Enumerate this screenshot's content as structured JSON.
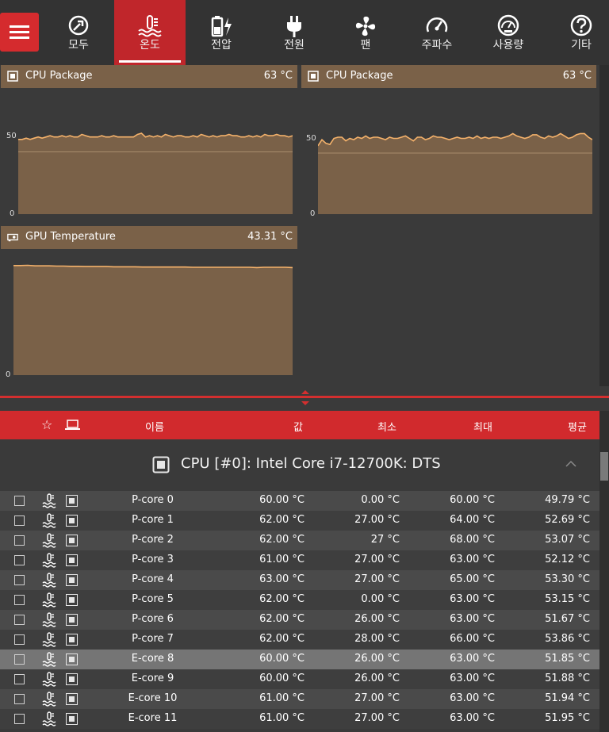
{
  "nav": {
    "items": [
      {
        "label": "모두",
        "icon": "wrench-gauge-icon"
      },
      {
        "label": "온도",
        "icon": "thermometer-icon",
        "active": true
      },
      {
        "label": "전압",
        "icon": "battery-bolt-icon"
      },
      {
        "label": "전원",
        "icon": "plug-icon"
      },
      {
        "label": "팬",
        "icon": "fan-icon"
      },
      {
        "label": "주파수",
        "icon": "speedometer-icon"
      },
      {
        "label": "사용량",
        "icon": "usage-gauge-icon"
      },
      {
        "label": "기타",
        "icon": "question-icon"
      }
    ]
  },
  "graphs": [
    {
      "title": "CPU Package",
      "value": "63 °C",
      "icon": "cpu-chip-icon",
      "y_ticks": [
        "50",
        "0"
      ],
      "ylim": [
        0,
        100
      ],
      "series": [
        60,
        60,
        61,
        60,
        61,
        62,
        61,
        62,
        63,
        62,
        62,
        63,
        62,
        63,
        62,
        62,
        64,
        63,
        62,
        62,
        62,
        63,
        62,
        62,
        63,
        62,
        62,
        62,
        62,
        62,
        64,
        65,
        62,
        63,
        62,
        63,
        62,
        64,
        63,
        62,
        63,
        63,
        62,
        62,
        63,
        62,
        64,
        63,
        62,
        63,
        62,
        63,
        63,
        64,
        63,
        63,
        62,
        62,
        63,
        62,
        63,
        62,
        64,
        63,
        63,
        64,
        63,
        63,
        62,
        63
      ]
    },
    {
      "title": "CPU Package",
      "value": "63 °C",
      "icon": "cpu-chip-icon",
      "y_ticks": [
        "50",
        "0"
      ],
      "ylim": [
        0,
        100
      ],
      "series": [
        56,
        61,
        58,
        57,
        62,
        63,
        63,
        60,
        62,
        61,
        63,
        62,
        64,
        62,
        63,
        63,
        62,
        61,
        63,
        62,
        62,
        63,
        64,
        62,
        60,
        63,
        63,
        61,
        62,
        64,
        63,
        63,
        62,
        61,
        62,
        63,
        62,
        62,
        63,
        62,
        64,
        62,
        63,
        62,
        63,
        63,
        62,
        63,
        64,
        66,
        64,
        63,
        62,
        63,
        65,
        65,
        63,
        62,
        64,
        63,
        64,
        66,
        64,
        62,
        63,
        65,
        66,
        66,
        63,
        61
      ]
    },
    {
      "title": "GPU Temperature",
      "value": "43.31 °C",
      "icon": "gpu-card-icon",
      "y_ticks": [
        "0"
      ],
      "ylim": [
        0,
        50
      ],
      "series": [
        44.0,
        44.0,
        44.1,
        43.9,
        43.9,
        43.9,
        43.8,
        43.8,
        43.7,
        43.7,
        43.6,
        43.6,
        43.6,
        43.6,
        43.5,
        43.5,
        43.5,
        43.5,
        43.4,
        43.4,
        43.4,
        43.4,
        43.4,
        43.4,
        43.4,
        43.3,
        43.3,
        43.3,
        43.3,
        43.3,
        43.3,
        43.3,
        43.3,
        43.3,
        43.2,
        43.3,
        43.3,
        43.3,
        43.3,
        43.2
      ]
    }
  ],
  "table": {
    "header": {
      "star": "☆",
      "name": "이름",
      "value": "값",
      "min": "최소",
      "max": "최대",
      "avg": "평균"
    },
    "group_title": "CPU [#0]: Intel Core i7-12700K: DTS",
    "rows": [
      {
        "name": "P-core 0",
        "value": "60.00 °C",
        "min": "0.00 °C",
        "max": "60.00 °C",
        "avg": "49.79 °C"
      },
      {
        "name": "P-core 1",
        "value": "62.00 °C",
        "min": "27.00 °C",
        "max": "64.00 °C",
        "avg": "52.69 °C"
      },
      {
        "name": "P-core 2",
        "value": "62.00 °C",
        "min": "27 °C",
        "max": "68.00 °C",
        "avg": "53.07 °C"
      },
      {
        "name": "P-core 3",
        "value": "61.00 °C",
        "min": "27.00 °C",
        "max": "63.00 °C",
        "avg": "52.12 °C"
      },
      {
        "name": "P-core 4",
        "value": "63.00 °C",
        "min": "27.00 °C",
        "max": "65.00 °C",
        "avg": "53.30 °C"
      },
      {
        "name": "P-core 5",
        "value": "62.00 °C",
        "min": "0.00 °C",
        "max": "63.00 °C",
        "avg": "53.15 °C"
      },
      {
        "name": "P-core 6",
        "value": "62.00 °C",
        "min": "26.00 °C",
        "max": "63.00 °C",
        "avg": "51.67 °C"
      },
      {
        "name": "P-core 7",
        "value": "62.00 °C",
        "min": "28.00 °C",
        "max": "66.00 °C",
        "avg": "53.86 °C"
      },
      {
        "name": "E-core 8",
        "value": "60.00 °C",
        "min": "26.00 °C",
        "max": "63.00 °C",
        "avg": "51.85 °C",
        "selected": true
      },
      {
        "name": "E-core 9",
        "value": "60.00 °C",
        "min": "26.00 °C",
        "max": "63.00 °C",
        "avg": "51.88 °C"
      },
      {
        "name": "E-core 10",
        "value": "61.00 °C",
        "min": "27.00 °C",
        "max": "63.00 °C",
        "avg": "51.94 °C"
      },
      {
        "name": "E-core 11",
        "value": "61.00 °C",
        "min": "27.00 °C",
        "max": "63.00 °C",
        "avg": "51.95 °C"
      }
    ]
  },
  "colors": {
    "accent": "#d12a2d",
    "graph_fill": "#7a6148",
    "graph_line": "#f5b26b"
  }
}
